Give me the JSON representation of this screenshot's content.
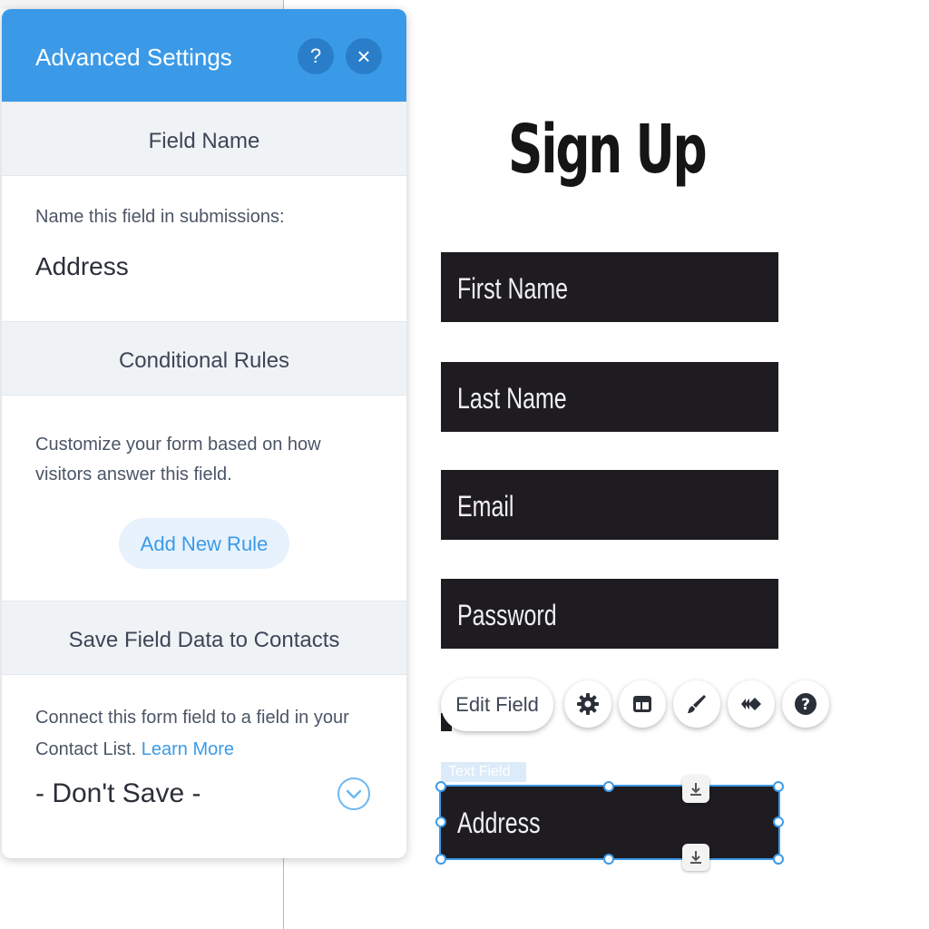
{
  "panel": {
    "title": "Advanced Settings",
    "help_icon": "question-icon",
    "close_icon": "close-icon",
    "field_name": {
      "heading": "Field Name",
      "label": "Name this field in submissions:",
      "value": "Address"
    },
    "conditional_rules": {
      "heading": "Conditional Rules",
      "description": "Customize your form based on how visitors answer this field.",
      "button_label": "Add New Rule"
    },
    "save_to_contacts": {
      "heading": "Save Field Data to Contacts",
      "description": "Connect this form field to a field in your Contact List.",
      "link_label": "Learn More",
      "dropdown_value": "- Don't Save -"
    }
  },
  "form": {
    "title": "Sign Up",
    "fields": [
      "First Name",
      "Last Name",
      "Email",
      "Password",
      "Address"
    ],
    "selected_tag": "Text Field"
  },
  "toolbar": {
    "edit_label": "Edit Field",
    "icons": [
      "gear-icon",
      "layout-icon",
      "brush-icon",
      "animation-icon",
      "help-icon"
    ]
  },
  "colors": {
    "accent": "#3b9ae8",
    "field_bg": "#1e1c21",
    "panel_section_bg": "#f0f3f6"
  }
}
